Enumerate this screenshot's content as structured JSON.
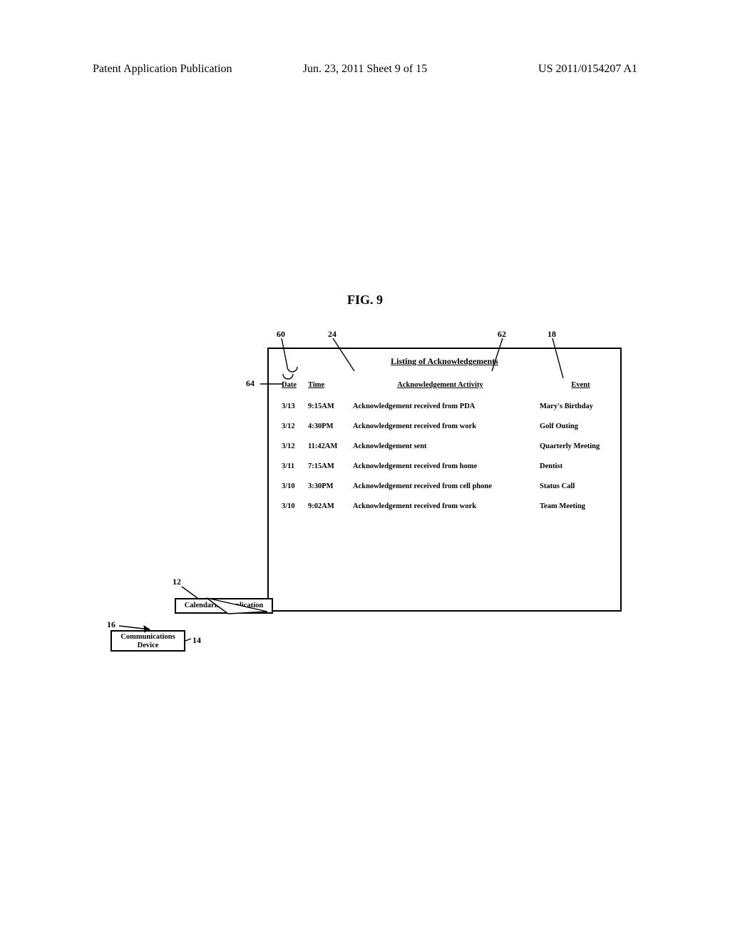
{
  "header": {
    "left": "Patent Application Publication",
    "center": "Jun. 23, 2011  Sheet 9 of 15",
    "right": "US 2011/0154207 A1"
  },
  "figure": {
    "title": "FIG. 9"
  },
  "window": {
    "title": "Listing of Acknowledgements",
    "cols": {
      "date": "Date",
      "time": "Time",
      "activity": "Acknowledgement Activity",
      "event": "Event"
    },
    "rows": [
      {
        "date": "3/13",
        "time": "9:15AM",
        "activity": "Acknowledgement received from PDA",
        "event": "Mary's Birthday"
      },
      {
        "date": "3/12",
        "time": "4:30PM",
        "activity": "Acknowledgement received from work",
        "event": "Golf Outing"
      },
      {
        "date": "3/12",
        "time": "11:42AM",
        "activity": "Acknowledgement sent",
        "event": "Quarterly Meeting"
      },
      {
        "date": "3/11",
        "time": "7:15AM",
        "activity": "Acknowledgement received from home",
        "event": "Dentist"
      },
      {
        "date": "3/10",
        "time": "3:30PM",
        "activity": "Acknowledgement received from cell phone",
        "event": "Status Call"
      },
      {
        "date": "3/10",
        "time": "9:02AM",
        "activity": "Acknowledgement received from work",
        "event": "Team Meeting"
      }
    ]
  },
  "boxes": {
    "calendaring": "Calendaring Application",
    "comm_device": "Communications\nDevice"
  },
  "refs": {
    "r60": "60",
    "r24": "24",
    "r62": "62",
    "r18": "18",
    "r64": "64",
    "r12": "12",
    "r16": "16",
    "r14": "14"
  }
}
